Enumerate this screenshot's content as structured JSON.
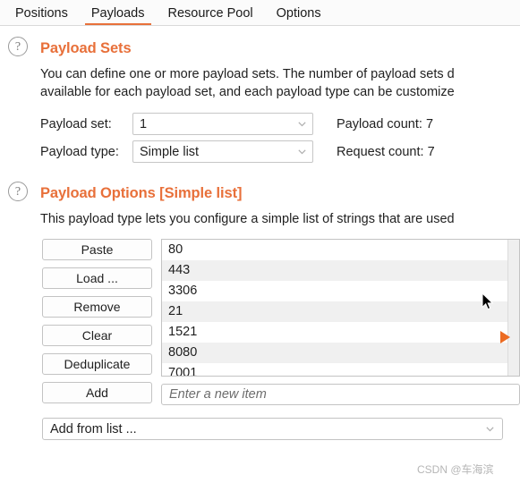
{
  "tabs": [
    {
      "label": "Positions",
      "active": false
    },
    {
      "label": "Payloads",
      "active": true
    },
    {
      "label": "Resource Pool",
      "active": false
    },
    {
      "label": "Options",
      "active": false
    }
  ],
  "payload_sets": {
    "help_icon": "question-mark-icon",
    "title": "Payload Sets",
    "description_line1": "You can define one or more payload sets. The number of payload sets d",
    "description_line2": "available for each payload set, and each payload type can be customize",
    "payload_set_label": "Payload set:",
    "payload_set_value": "1",
    "payload_type_label": "Payload type:",
    "payload_type_value": "Simple list",
    "payload_count": "Payload count: 7",
    "request_count": "Request count: 7"
  },
  "payload_options": {
    "help_icon": "question-mark-icon",
    "title": "Payload Options [Simple list]",
    "description": "This payload type lets you configure a simple list of strings that are used",
    "buttons": [
      {
        "label": "Paste"
      },
      {
        "label": "Load ..."
      },
      {
        "label": "Remove"
      },
      {
        "label": "Clear"
      },
      {
        "label": "Deduplicate"
      },
      {
        "label": "Add"
      },
      {
        "label": "Add from list ..."
      }
    ],
    "list_items": [
      "80",
      "443",
      "3306",
      "21",
      "1521",
      "8080",
      "7001"
    ],
    "new_item_placeholder": "Enter a new item",
    "add_from_list_value": "Add from list ..."
  },
  "decorations": {
    "watermark": "CSDN @车海滨",
    "accent_color": "#e8703a",
    "arrow_color": "#ec6b22",
    "cursor": "mouse-pointer-icon"
  }
}
